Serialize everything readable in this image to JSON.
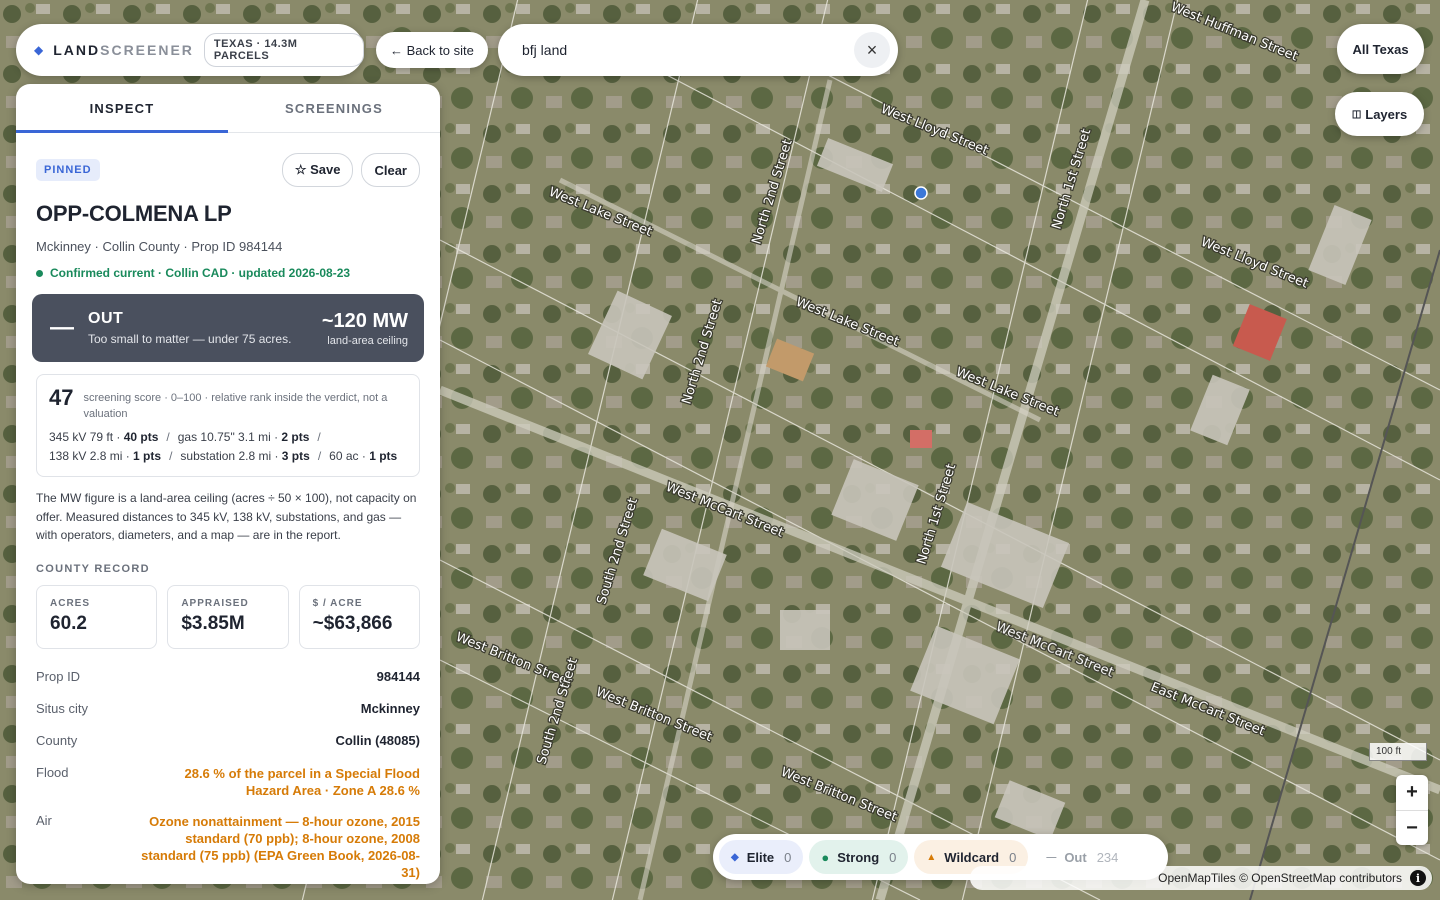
{
  "brand": {
    "logo_a": "LAND",
    "logo_b": "SCREENER",
    "chip": "TEXAS · 14.3M PARCELS"
  },
  "back_label": "← Back to site",
  "search": {
    "value": "bfj land",
    "clear": "×"
  },
  "region_button": "All Texas",
  "layers_button": "Layers",
  "layers_icon": "◫",
  "tabs": [
    {
      "label": "INSPECT",
      "active": true
    },
    {
      "label": "SCREENINGS",
      "active": false
    }
  ],
  "parcel": {
    "badge": "PINNED",
    "save": "☆ Save",
    "clear": "Clear",
    "owner": "OPP-COLMENA LP",
    "location": "Mckinney · Collin County · Prop ID 984144",
    "status": "Confirmed current · Collin CAD · updated 2026-08-23"
  },
  "verdict": {
    "dash": "—",
    "title": "OUT",
    "subtitle": "Too small to matter — under 75 acres.",
    "mw": "~120 MW",
    "mw_label": "land-area ceiling"
  },
  "score": {
    "value": "47",
    "desc": "screening score · 0–100 · relative rank inside the verdict, not a valuation",
    "line1": [
      {
        "t": "345 kV 79 ft · ",
        "b": "40 pts"
      },
      {
        "t": "gas 10.75\" 3.1 mi · ",
        "b": "2 pts"
      }
    ],
    "line2": [
      {
        "t": "138 kV 2.8 mi · ",
        "b": "1 pts"
      },
      {
        "t": "substation 2.8 mi · ",
        "b": "3 pts"
      },
      {
        "t": "60 ac · ",
        "b": "1 pts"
      }
    ]
  },
  "note": "The MW figure is a land-area ceiling (acres ÷ 50 × 100), not capacity on offer. Measured distances to 345 kV, 138 kV, substations, and gas — with operators, diameters, and a map — are in the report.",
  "county_record": {
    "title": "COUNTY RECORD",
    "cards": [
      {
        "label": "ACRES",
        "value": "60.2"
      },
      {
        "label": "APPRAISED",
        "value": "$3.85M"
      },
      {
        "label": "$ / ACRE",
        "value": "~$63,866"
      }
    ],
    "rows": [
      {
        "k": "Prop ID",
        "v": "984144"
      },
      {
        "k": "Situs city",
        "v": "Mckinney"
      },
      {
        "k": "County",
        "v": "Collin (48085)"
      },
      {
        "k": "Flood",
        "v": "28.6 % of the parcel in a Special Flood Hazard Area · Zone A 28.6 %"
      },
      {
        "k": "Air",
        "v": "Ozone nonattainment — 8-hour ozone, 2015 standard (70 ppb); 8-hour ozone, 2008 standard (75 ppb) (EPA Green Book, 2026-08-31)"
      }
    ]
  },
  "legend": [
    {
      "label": "Elite",
      "count": "0",
      "marker": "◆",
      "color": "#3a66d6"
    },
    {
      "label": "Strong",
      "count": "0",
      "marker": "●",
      "color": "#1a8a5c"
    },
    {
      "label": "Wildcard",
      "count": "0",
      "marker": "▲",
      "color": "#d67b07"
    },
    {
      "label": "Out",
      "count": "234",
      "marker": "—",
      "color": "#9aa0a8"
    }
  ],
  "scale": "100 ft",
  "zoom": {
    "in": "+",
    "out": "−"
  },
  "attribution": "OpenMapTiles © OpenStreetMap contributors",
  "streets": [
    "West Huffman Street",
    "West Lloyd Street",
    "North 1st Street",
    "West Lake Street",
    "North 2nd Street",
    "West McCart Street",
    "East McCart Street",
    "South 2nd Street",
    "West Britton Street",
    "North 1st Street",
    "West Lake Street",
    "West Lloyd Street",
    "North 2nd Street",
    "West Britton Street",
    "West Britton Street",
    "West Lake Street",
    "West McCart Street",
    "South 2nd Street"
  ],
  "colors": {
    "accent": "#3a66d6",
    "verdict_bg": "#4a505e",
    "confirmed": "#1a8a5c",
    "warning": "#d67b07"
  }
}
